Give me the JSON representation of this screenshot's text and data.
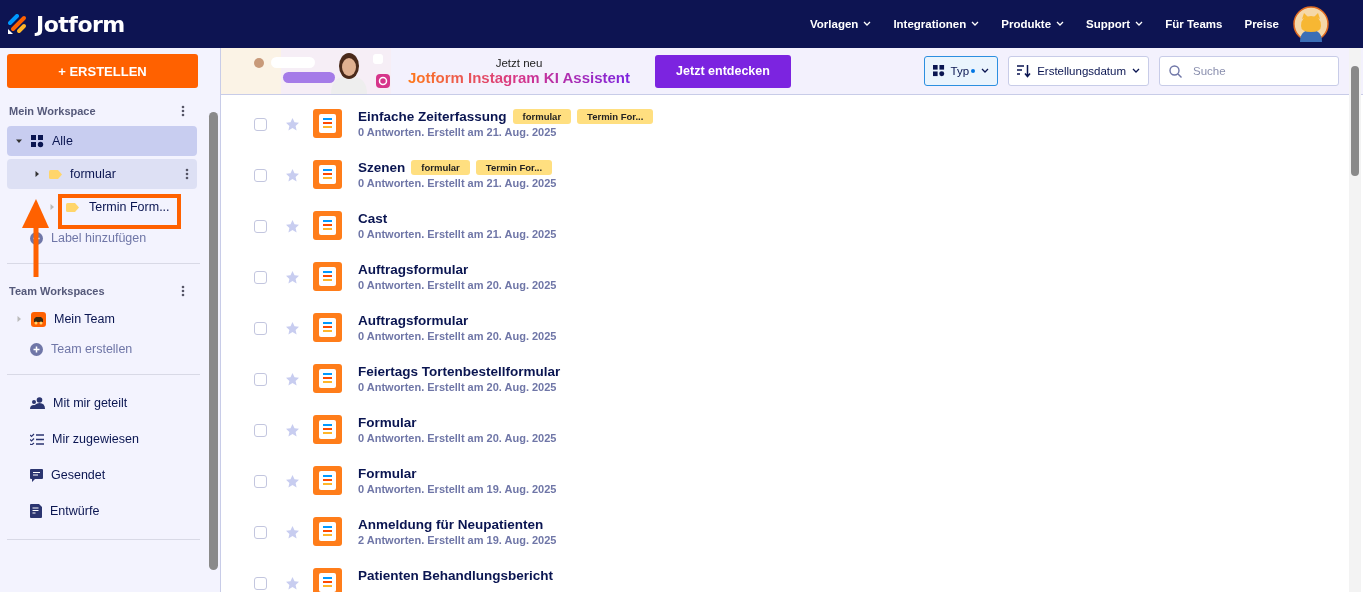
{
  "nav": {
    "brand": "Jotform",
    "links": [
      {
        "label": "Vorlagen",
        "dropdown": true
      },
      {
        "label": "Integrationen",
        "dropdown": true
      },
      {
        "label": "Produkte",
        "dropdown": true
      },
      {
        "label": "Support",
        "dropdown": true
      },
      {
        "label": "Für Teams",
        "dropdown": false
      },
      {
        "label": "Preise",
        "dropdown": false
      }
    ]
  },
  "sidebar": {
    "create_button": "+ ERSTELLEN",
    "workspace_title": "Mein Workspace",
    "tree": [
      {
        "label": "Alle",
        "kind": "all",
        "expanded": true,
        "selected": true,
        "children": [
          {
            "label": "formular",
            "kind": "label",
            "expanded": false,
            "selected": false,
            "children": [
              {
                "label": "Termin Form...",
                "kind": "label",
                "expanded": false,
                "selected": false
              }
            ]
          }
        ]
      }
    ],
    "add_label": "Label hinzufügen",
    "team_title": "Team Workspaces",
    "team": {
      "label": "Mein Team",
      "expanded": false
    },
    "create_team": "Team erstellen",
    "links": [
      {
        "label": "Mit mir geteilt",
        "kind": "shared"
      },
      {
        "label": "Mir zugewiesen",
        "kind": "assigned"
      },
      {
        "label": "Gesendet",
        "kind": "sent"
      },
      {
        "label": "Entwürfe",
        "kind": "drafts"
      }
    ]
  },
  "banner": {
    "kicker": "Jetzt neu",
    "headline": "Jotform Instagram KI Assistent",
    "button": "Jetzt entdecken"
  },
  "toolbar": {
    "type_filter": {
      "label": "Typ",
      "active": true
    },
    "sort": {
      "label": "Erstellungsdatum"
    },
    "search": {
      "placeholder": "Suche"
    }
  },
  "forms": [
    {
      "title": "Einfache Zeiterfassung",
      "tags": [
        "formular",
        "Termin For..."
      ],
      "meta": "0 Antworten. Erstellt am 21. Aug. 2025",
      "checked": false,
      "starred": false
    },
    {
      "title": "Szenen",
      "tags": [
        "formular",
        "Termin For..."
      ],
      "meta": "0 Antworten. Erstellt am 21. Aug. 2025",
      "checked": false,
      "starred": false
    },
    {
      "title": "Cast",
      "meta": "0 Antworten. Erstellt am 21. Aug. 2025",
      "checked": false,
      "starred": false
    },
    {
      "title": "Auftragsformular",
      "meta": "0 Antworten. Erstellt am 20. Aug. 2025",
      "checked": false,
      "starred": false
    },
    {
      "title": "Auftragsformular",
      "meta": "0 Antworten. Erstellt am 20. Aug. 2025",
      "checked": false,
      "starred": false
    },
    {
      "title": "Feiertags Tortenbestellformular",
      "meta": "0 Antworten. Erstellt am 20. Aug. 2025",
      "checked": false,
      "starred": false
    },
    {
      "title": "Formular",
      "meta": "0 Antworten. Erstellt am 20. Aug. 2025",
      "checked": false,
      "starred": false
    },
    {
      "title": "Formular",
      "meta": "0 Antworten. Erstellt am 19. Aug. 2025",
      "checked": false,
      "starred": false
    },
    {
      "title": "Anmeldung für Neupatienten",
      "meta": "2 Antworten. Erstellt am 19. Aug. 2025",
      "checked": false,
      "starred": false
    },
    {
      "title": "Patienten Behandlungsbericht",
      "checked": false,
      "starred": false
    }
  ]
}
